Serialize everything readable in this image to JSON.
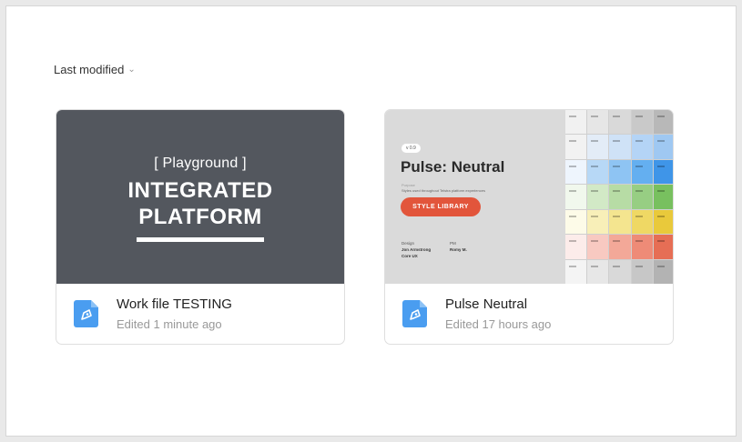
{
  "sort": {
    "label": "Last modified"
  },
  "files": [
    {
      "title": "Work file TESTING",
      "edited": "Edited 1 minute ago",
      "thumbnail": {
        "playground": "[ Playground ]",
        "line1": "INTEGRATED",
        "line2": "PLATFORM"
      }
    },
    {
      "title": "Pulse Neutral",
      "edited": "Edited 17 hours ago",
      "thumbnail": {
        "badge": "v 0.9",
        "title": "Pulse: Neutral",
        "sub1": "Purpose",
        "sub2": "Styles used throughout Telstra platform experiences",
        "button": "STYLE LIBRARY",
        "design_label": "Design",
        "designer": "Jon Armstrong",
        "team": "Core UX",
        "pm_label": "PM",
        "pm": "Romy M."
      }
    }
  ],
  "colors": {
    "thumb_dark": "#53575e",
    "pulse_bg": "#dadada",
    "style_button": "#e2553b",
    "file_icon": "#4a9df0",
    "palette_rows": [
      [
        "#f1f1f1",
        "#e6e6e6",
        "#d9d9d9",
        "#c9c9c9",
        "#b8b8b8"
      ],
      [
        "#f2f2f2",
        "#e3ecf7",
        "#cfe2f7",
        "#b4d4f6",
        "#9fc8f2"
      ],
      [
        "#eef5fd",
        "#b7d8f6",
        "#8ec4f3",
        "#64aff0",
        "#3f95e8"
      ],
      [
        "#f1f8ed",
        "#d2e9c6",
        "#b7dca5",
        "#97ce83",
        "#78c05f"
      ],
      [
        "#fdfbe8",
        "#f8efb8",
        "#f4e58f",
        "#efd864",
        "#e9c93b"
      ],
      [
        "#fcecea",
        "#f8c9c1",
        "#f3a898",
        "#ee8b77",
        "#e66e55"
      ],
      [
        "#f4f4f4",
        "#e7e7e7",
        "#d9d9d9",
        "#c7c7c7",
        "#b3b3b3"
      ]
    ]
  }
}
